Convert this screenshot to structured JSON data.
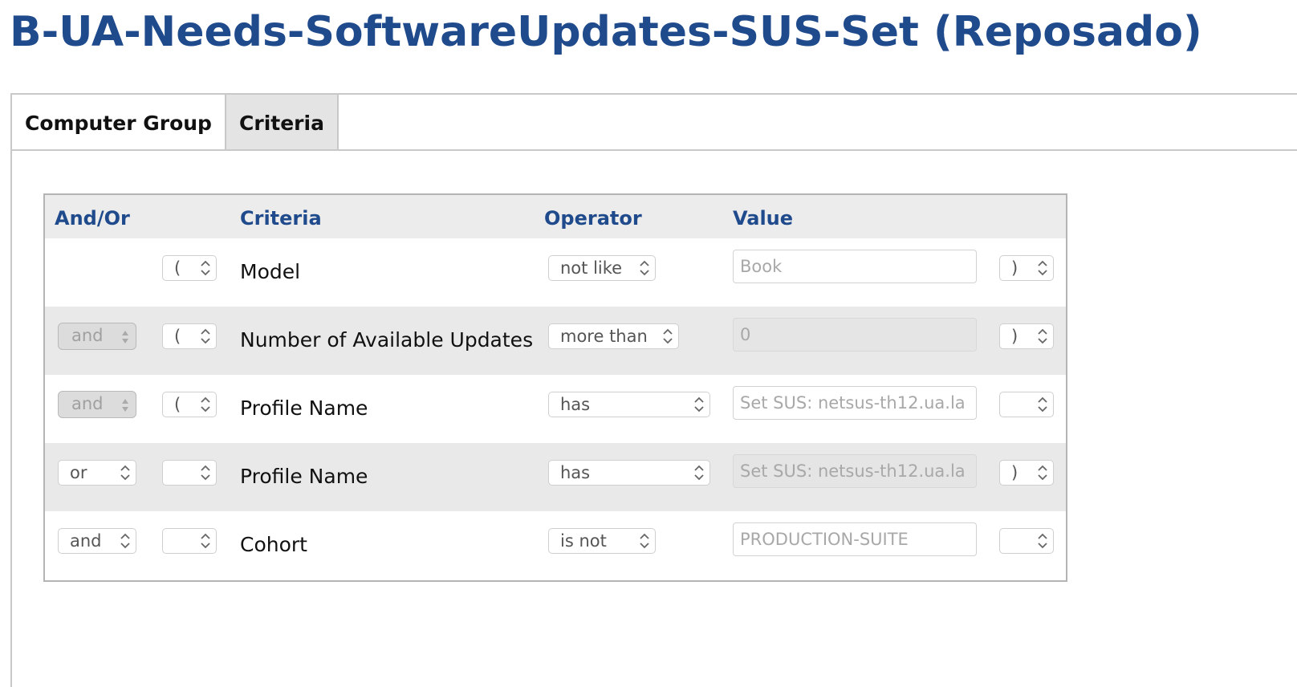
{
  "page": {
    "title": "B-UA-Needs-SoftwareUpdates-SUS-Set (Reposado)"
  },
  "tabs": [
    {
      "label": "Computer Group"
    },
    {
      "label": "Criteria"
    }
  ],
  "table": {
    "headers": {
      "and_or": "And/Or",
      "criteria": "Criteria",
      "operator": "Operator",
      "value": "Value"
    },
    "rows": [
      {
        "and_or": "",
        "open_paren": "(",
        "criteria": "Model",
        "operator": "not like",
        "value": "Book",
        "close_paren": ")"
      },
      {
        "and_or": "and",
        "open_paren": "(",
        "criteria": "Number of Available Updates",
        "operator": "more than",
        "value": "0",
        "close_paren": ")"
      },
      {
        "and_or": "and",
        "open_paren": "(",
        "criteria": "Profile Name",
        "operator": "has",
        "value": "Set SUS: netsus-th12.ua.la",
        "close_paren": ""
      },
      {
        "and_or": "or",
        "open_paren": "",
        "criteria": "Profile Name",
        "operator": "has",
        "value": "Set SUS: netsus-th12.ua.la",
        "close_paren": ")"
      },
      {
        "and_or": "and",
        "open_paren": "",
        "criteria": "Cohort",
        "operator": "is not",
        "value": "PRODUCTION-SUITE",
        "close_paren": ""
      }
    ]
  },
  "colors": {
    "title": "#1f4a8c",
    "header_text": "#1f4a8c",
    "row_shaded": "#e9e9e9",
    "header_bg": "#ececec"
  },
  "icons": {
    "stepper": "chevron-up-down-icon"
  }
}
